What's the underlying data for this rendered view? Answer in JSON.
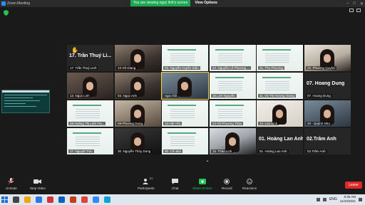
{
  "window": {
    "title": "Zoom Meeting"
  },
  "share_banner": {
    "viewing_text": "You are viewing ngọc linh's screen",
    "view_options": "View Options"
  },
  "tiles": [
    {
      "id": "t1",
      "name": "17. Trần Thuý Linh",
      "big": "17. Trần Thuý Li...",
      "kind": "dark"
    },
    {
      "id": "t2",
      "name": "12-Vũ Giang",
      "kind": "cam1"
    },
    {
      "id": "t3",
      "name": "06. Nguyễn Huyền Diệu",
      "kind": "slide"
    },
    {
      "id": "t4",
      "name": "22. Nguyễn Lê Phương ...",
      "kind": "slide"
    },
    {
      "id": "t5",
      "name": "21. Thu Phương",
      "kind": "slide"
    },
    {
      "id": "t6",
      "name": "22. Phương Quyên",
      "kind": "cam2"
    },
    {
      "id": "t7",
      "name": "13. Ngọc Linh",
      "kind": "cam3"
    },
    {
      "id": "t8",
      "name": "03. Ngọc Anh",
      "kind": "cam1"
    },
    {
      "id": "t9",
      "name": "ngọc hồi",
      "kind": "cam5"
    },
    {
      "id": "t10",
      "name": "16.Linh Nguyễn",
      "kind": "slide"
    },
    {
      "id": "t11",
      "name": "11. Võ Thị Hương Giang",
      "kind": "slide"
    },
    {
      "id": "t12",
      "name": "07. Hoang Dung",
      "big": "07. Hoang Dung",
      "kind": "dark"
    },
    {
      "id": "t13",
      "name": "26-Hoàng Thị Linh Tra...",
      "kind": "slide"
    },
    {
      "id": "t14",
      "name": "08-Phương Dung",
      "kind": "cam6"
    },
    {
      "id": "t15",
      "name": "10-Hải Yến",
      "kind": "slide"
    },
    {
      "id": "t16",
      "name": "24-Vũ Phương Thảo",
      "kind": "slide"
    },
    {
      "id": "t17",
      "name": "14. Lưu Linh",
      "kind": "cam8"
    },
    {
      "id": "t18",
      "name": "20 - Quỳnh Như",
      "kind": "cam5"
    },
    {
      "id": "t19",
      "name": "27. Nguyệt Trúc",
      "kind": "slide"
    },
    {
      "id": "t20",
      "name": "30. Nguyễn Thùy Dung",
      "kind": "cam7"
    },
    {
      "id": "t21",
      "name": "30. Chi Mai",
      "kind": "slide"
    },
    {
      "id": "t22",
      "name": "15. Thảo Linh",
      "kind": "cam4"
    },
    {
      "id": "t23",
      "name": "01. Hoàng Lan Anh",
      "big": "01. Hoàng Lan Anh",
      "kind": "dark"
    },
    {
      "id": "t24",
      "name": "02.Trâm Anh",
      "big": "02.Trâm Anh",
      "kind": "dark"
    }
  ],
  "toolbar": {
    "unmute": "Unmute",
    "stop_video": "Stop Video",
    "participants": "Participants",
    "participants_count": "21",
    "chat": "Chat",
    "share_screen": "Share Screen",
    "record": "Record",
    "reactions": "Reactions",
    "leave": "Leave"
  },
  "taskbar": {
    "lang": "ENG",
    "time": "8:36 AM",
    "date": "11/10/2021"
  },
  "colors": {
    "share_green": "#1fa854",
    "leave_red": "#e02828",
    "tile_highlight": "#f4d03f"
  }
}
